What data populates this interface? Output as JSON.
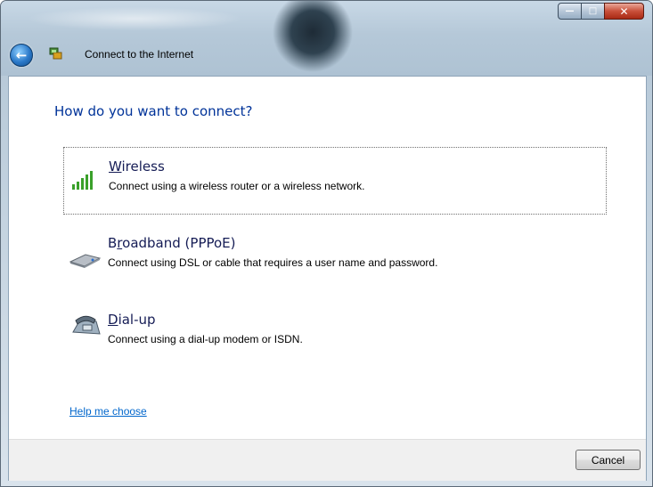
{
  "window": {
    "title": "Connect to the Internet",
    "buttons": {
      "minimize": "—",
      "maximize": "□",
      "close": "✕"
    }
  },
  "main": {
    "heading": "How do you want to connect?",
    "options": [
      {
        "accel": "W",
        "rest": "ireless",
        "description": "Connect using a wireless router or a wireless network.",
        "icon": "wireless-signal-icon"
      },
      {
        "pre": "B",
        "accel": "r",
        "rest": "oadband (PPPoE)",
        "description": "Connect using DSL or cable that requires a user name and password.",
        "icon": "broadband-modem-icon"
      },
      {
        "accel": "D",
        "rest": "ial-up",
        "description": "Connect using a dial-up modem or ISDN.",
        "icon": "dialup-phone-icon"
      }
    ],
    "help_link": "Help me choose"
  },
  "footer": {
    "cancel_label": "Cancel"
  },
  "colors": {
    "heading": "#003399",
    "link": "#0066cc",
    "close_button": "#c9503a"
  }
}
